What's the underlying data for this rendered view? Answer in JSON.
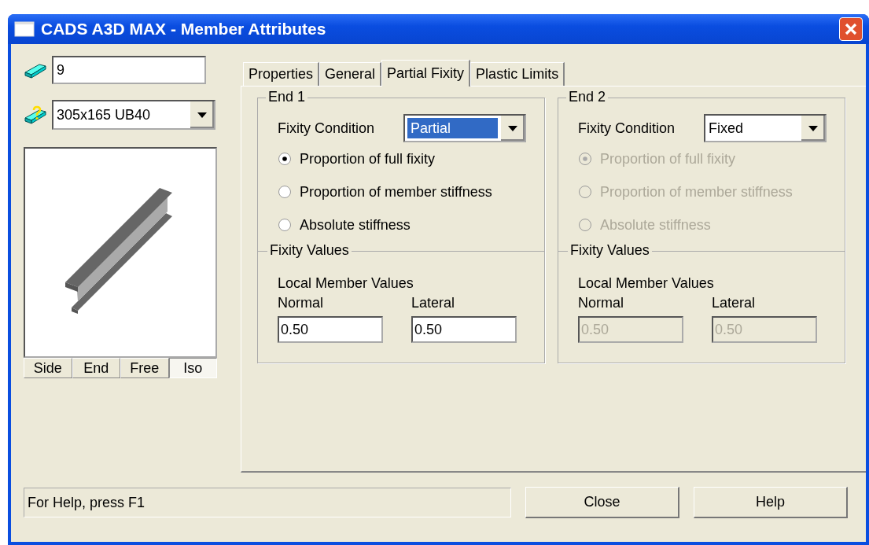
{
  "window": {
    "title": "CADS A3D MAX - Member Attributes"
  },
  "member_number": {
    "value": "9"
  },
  "section": {
    "value": "305x165 UB40"
  },
  "view_buttons": [
    {
      "label": "Side",
      "selected": false
    },
    {
      "label": "End",
      "selected": false
    },
    {
      "label": "Free",
      "selected": false
    },
    {
      "label": "Iso",
      "selected": true
    }
  ],
  "tabs": [
    {
      "label": "Properties",
      "selected": false
    },
    {
      "label": "General",
      "selected": false
    },
    {
      "label": "Partial Fixity",
      "selected": true
    },
    {
      "label": "Plastic Limits",
      "selected": false
    }
  ],
  "ends": [
    {
      "title": "End 1",
      "condition_label": "Fixity Condition",
      "condition": "Partial",
      "condition_focused": true,
      "options": [
        {
          "label": "Proportion of full fixity",
          "selected": true,
          "disabled": false
        },
        {
          "label": "Proportion of member stiffness",
          "selected": false,
          "disabled": false
        },
        {
          "label": "Absolute stiffness",
          "selected": false,
          "disabled": false
        }
      ],
      "values_title": "Fixity Values",
      "values_subtitle": "Local Member Values",
      "fields": [
        {
          "label": "Normal",
          "value": "0.50",
          "disabled": false
        },
        {
          "label": "Lateral",
          "value": "0.50",
          "disabled": false
        }
      ]
    },
    {
      "title": "End 2",
      "condition_label": "Fixity Condition",
      "condition": "Fixed",
      "condition_focused": false,
      "options": [
        {
          "label": "Proportion of full fixity",
          "selected": true,
          "disabled": true
        },
        {
          "label": "Proportion of member stiffness",
          "selected": false,
          "disabled": true
        },
        {
          "label": "Absolute stiffness",
          "selected": false,
          "disabled": true
        }
      ],
      "values_title": "Fixity Values",
      "values_subtitle": "Local Member Values",
      "fields": [
        {
          "label": "Normal",
          "value": "0.50",
          "disabled": true
        },
        {
          "label": "Lateral",
          "value": "0.50",
          "disabled": true
        }
      ]
    }
  ],
  "status_bar": {
    "text": "For Help, press F1"
  },
  "buttons": [
    "Close",
    "Help"
  ]
}
